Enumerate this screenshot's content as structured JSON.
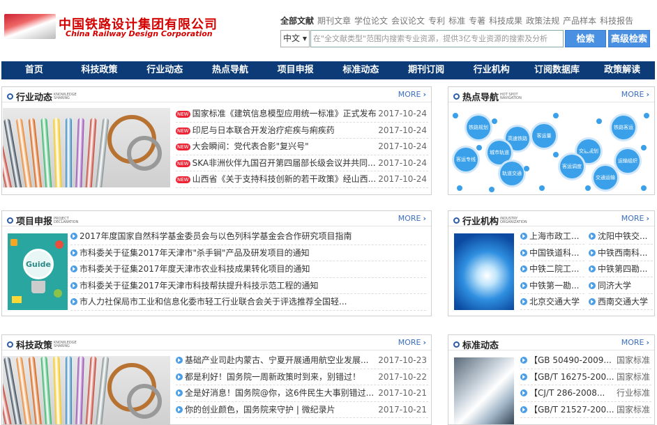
{
  "header": {
    "logo_cn": "中国铁路设计集团有限公司",
    "logo_en": "China Railway Design Corporation",
    "doc_types": [
      "全部文献",
      "期刊文章",
      "学位论文",
      "会议论文",
      "专利",
      "标准",
      "专著",
      "科技成果",
      "政策法规",
      "产品样本",
      "科技报告"
    ],
    "lang": "中文",
    "search_placeholder": "在\"全文献类型\"范围内搜索专业资源，提供3亿专业资源的搜索及分析",
    "search_btn": "检索",
    "adv_search_btn": "高级检索"
  },
  "nav": [
    "首页",
    "科技政策",
    "行业动态",
    "热点导航",
    "项目申报",
    "标准动态",
    "期刊订阅",
    "行业机构",
    "订阅数据库",
    "政策解读"
  ],
  "more_label": "MORE",
  "industry_news": {
    "title": "行业动态",
    "subtitle": "KNOWLEDGE SHARING",
    "items": [
      {
        "text": "国家标准《建筑信息模型应用统一标准》正式发布",
        "date": "2017-10-24"
      },
      {
        "text": "印尼与日本联合开发治疗疟疾与痢疾药",
        "date": "2017-10-24"
      },
      {
        "text": "大会瞬间：党代表合影\"复兴号\"",
        "date": "2017-10-24"
      },
      {
        "text": "SKA非洲伙伴九国召开第四届部长级会议并共同...",
        "date": "2017-10-24"
      },
      {
        "text": "山西省《关于支持科技创新的若干政策》经山西...",
        "date": "2017-10-24"
      }
    ],
    "new_badge": "NEW"
  },
  "hot_nav": {
    "title": "热点导航",
    "subtitle": "HOT SPOT NAVIGATION",
    "bubbles": [
      "铁路规划",
      "高速铁路",
      "铁路客运",
      "客运专线",
      "城市轨道",
      "客运量",
      "交通规划",
      "运输组织",
      "轨道交通",
      "客运调度",
      "交通运输"
    ]
  },
  "projects": {
    "title": "项目申报",
    "subtitle": "PROJECT DECLARATION",
    "thumb_text": "Guide",
    "items": [
      "2017年度国家自然科学基金委员会与以色列科学基金会合作研究项目指南",
      "市科委关于征集2017年天津市\"杀手锏\"产品及研发项目的通知",
      "市科委关于征集2017年度天津市农业科技成果转化项目的通知",
      "市科委关于征集2017年天津市科技帮扶提升科技示范工程的通知",
      "市人力社保局市工业和信息化委市轻工行业联合会关于评选推荐全国轻..."
    ]
  },
  "institutions": {
    "title": "行业机构",
    "subtitle": "INDUSTRY ORGANIZATION",
    "items": [
      "上海市政工...",
      "沈阳中铁交...",
      "中国铁道科...",
      "中铁西南科...",
      "中铁二院工...",
      "中铁第四勘...",
      "中铁第一勘...",
      "同济大学",
      "北京交通大学",
      "西南交通大学"
    ]
  },
  "tech_policy": {
    "title": "科技政策",
    "subtitle": "KNOWLEDGE SHARING",
    "items": [
      {
        "text": "基础产业司赴内蒙古、宁夏开展通用航空业发展...",
        "date": "2017-10-23"
      },
      {
        "text": "都是利好！国务院一周新政策时到来，别错过！",
        "date": "2017-10-22"
      },
      {
        "text": "全是好消息！国务院@你，这6件民生大事别错过...",
        "date": "2017-10-21"
      },
      {
        "text": "你的创业颜色，国务院来守护 | 微纪录片",
        "date": "2017-10-21"
      }
    ]
  },
  "standards": {
    "title": "标准动态",
    "items": [
      {
        "text": "【GB 50490-2009...",
        "cat": "国家标准"
      },
      {
        "text": "【GB/T 16275-200...",
        "cat": "国家标准"
      },
      {
        "text": "【CJ/T 286-2008...",
        "cat": "行业标准"
      },
      {
        "text": "【GB/T 21527-200...",
        "cat": "国家标准"
      }
    ]
  },
  "colors": {
    "nav_bg": "#0c3b78",
    "accent": "#4a90e2",
    "logo_red": "#d40000"
  }
}
